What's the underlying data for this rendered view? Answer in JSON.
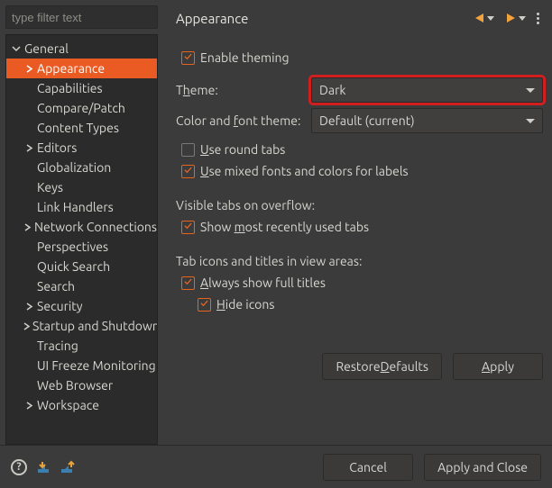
{
  "filter": {
    "placeholder": "type filter text"
  },
  "tree": {
    "root": {
      "label": "General"
    },
    "items": [
      {
        "label": "Appearance",
        "exp": true,
        "sel": true
      },
      {
        "label": "Capabilities",
        "exp": false
      },
      {
        "label": "Compare/Patch",
        "exp": false
      },
      {
        "label": "Content Types",
        "exp": false
      },
      {
        "label": "Editors",
        "exp": true
      },
      {
        "label": "Globalization",
        "exp": false
      },
      {
        "label": "Keys",
        "exp": false
      },
      {
        "label": "Link Handlers",
        "exp": false
      },
      {
        "label": "Network Connections",
        "exp": true
      },
      {
        "label": "Perspectives",
        "exp": false
      },
      {
        "label": "Quick Search",
        "exp": false
      },
      {
        "label": "Search",
        "exp": false
      },
      {
        "label": "Security",
        "exp": true
      },
      {
        "label": "Startup and Shutdown",
        "exp": true
      },
      {
        "label": "Tracing",
        "exp": false
      },
      {
        "label": "UI Freeze Monitoring",
        "exp": false
      },
      {
        "label": "Web Browser",
        "exp": false
      },
      {
        "label": "Workspace",
        "exp": true
      }
    ]
  },
  "header": {
    "title": "Appearance"
  },
  "form": {
    "enable_theming": "Enable theming",
    "theme_label_pre": "T",
    "theme_label_mn": "h",
    "theme_label_post": "eme:",
    "theme_value": "Dark",
    "cft_label_pre": "Color and ",
    "cft_label_mn": "f",
    "cft_label_post": "ont theme:",
    "cft_value": "Default (current)",
    "round_tabs_pre": "",
    "round_tabs_mn": "U",
    "round_tabs_post": "se round tabs",
    "mixed_fonts_pre": "",
    "mixed_fonts_mn": "U",
    "mixed_fonts_post": "se mixed fonts and colors for labels",
    "visible_tabs_title": "Visible tabs on overflow:",
    "show_most_pre": "Show ",
    "show_most_mn": "m",
    "show_most_post": "ost recently used tabs",
    "tab_icons_title": "Tab icons and titles in view areas:",
    "always_full_pre": "",
    "always_full_mn": "A",
    "always_full_post": "lways show full titles",
    "hide_icons_pre": "",
    "hide_icons_mn": "H",
    "hide_icons_post": "ide icons"
  },
  "buttons": {
    "restore_pre": "Restore ",
    "restore_mn": "D",
    "restore_post": "efaults",
    "apply_pre": "",
    "apply_mn": "A",
    "apply_post": "pply",
    "cancel": "Cancel",
    "apply_close": "Apply and Close"
  }
}
